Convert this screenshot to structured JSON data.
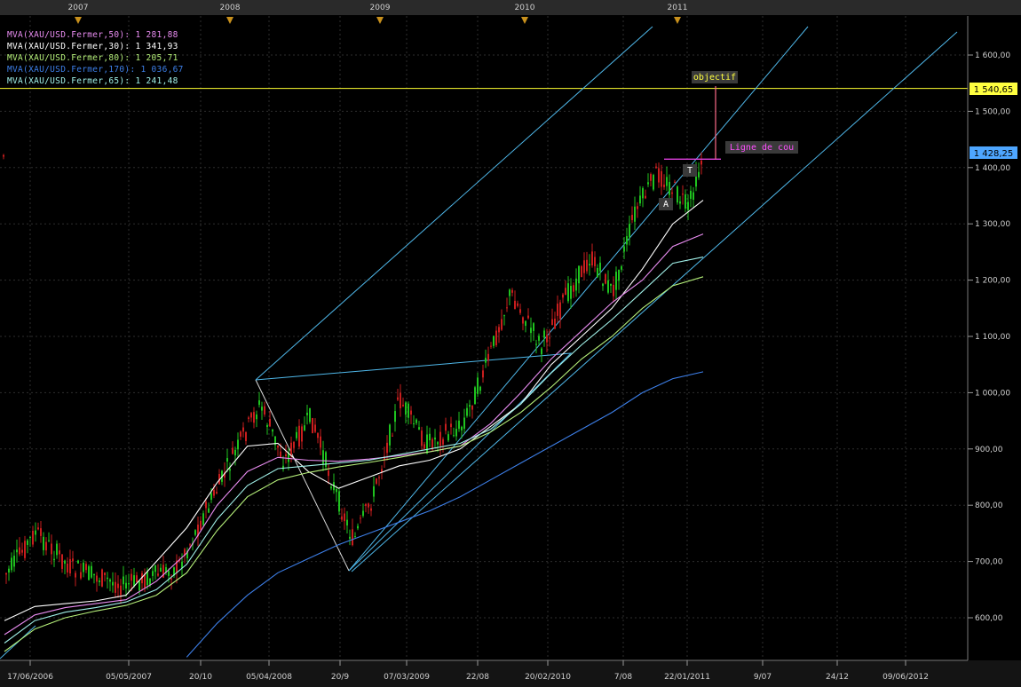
{
  "legend": [
    {
      "text": "MVA(XAU/USD.Fermer,50): 1 281,88",
      "color": "#e88cf0"
    },
    {
      "text": "MVA(XAU/USD.Fermer,30): 1 341,93",
      "color": "#ffffff"
    },
    {
      "text": "MVA(XAU/USD.Fermer,80): 1 205,71",
      "color": "#b6f07a"
    },
    {
      "text": "MVA(XAU/USD.Fermer,170): 1 036,67",
      "color": "#3d7fe8"
    },
    {
      "text": "MVA(XAU/USD.Fermer,65): 1 241,48",
      "color": "#a0f0e8"
    }
  ],
  "annotations": {
    "objectif": "objectif",
    "ligne_de_cou": "Ligne de cou",
    "label_a": "A",
    "label_t": "T"
  },
  "price_tags": {
    "target": "1 540,65",
    "current": "1 428,25"
  },
  "chart_data": {
    "type": "line",
    "instrument": "XAU/USD",
    "ylim": [
      530,
      1660
    ],
    "y_ticks": [
      "600,00",
      "700,00",
      "800,00",
      "900,00",
      "1 000,00",
      "1 100,00",
      "1 200,00",
      "1 300,00",
      "1 400,00",
      "1 500,00",
      "1 600,00"
    ],
    "y_tick_values": [
      600,
      700,
      800,
      900,
      1000,
      1100,
      1200,
      1300,
      1400,
      1500,
      1600
    ],
    "x_ticks_bottom": [
      "17/06/2006",
      "05/05/2007",
      "20/10",
      "05/04/2008",
      "20/9",
      "07/03/2009",
      "22/08",
      "20/02/2010",
      "7/08",
      "22/01/2011",
      "9/07",
      "24/12",
      "09/06/2012"
    ],
    "x_ticks_top": [
      "2007",
      "2008",
      "2009",
      "2010",
      "2011"
    ],
    "horizontal_line": 1540.65,
    "last_price": 1428.25,
    "neckline": 1415,
    "series": [
      {
        "name": "MVA(XAU/USD.Fermer,30)",
        "color": "#ffffff",
        "values": [
          595,
          620,
          625,
          630,
          640,
          700,
          760,
          840,
          905,
          910,
          860,
          830,
          850,
          870,
          880,
          900,
          940,
          980,
          1050,
          1100,
          1150,
          1220,
          1300,
          1342
        ]
      },
      {
        "name": "MVA(XAU/USD.Fermer,50)",
        "color": "#e88cf0",
        "values": [
          570,
          605,
          618,
          625,
          632,
          665,
          715,
          800,
          860,
          885,
          880,
          878,
          882,
          888,
          895,
          905,
          945,
          1000,
          1060,
          1110,
          1160,
          1200,
          1260,
          1282
        ]
      },
      {
        "name": "MVA(XAU/USD.Fermer,65)",
        "color": "#a0f0e8",
        "values": [
          555,
          595,
          610,
          618,
          628,
          650,
          695,
          775,
          835,
          865,
          870,
          875,
          880,
          890,
          900,
          910,
          935,
          980,
          1035,
          1085,
          1130,
          1180,
          1230,
          1241
        ]
      },
      {
        "name": "MVA(XAU/USD.Fermer,80)",
        "color": "#b6f07a",
        "values": [
          540,
          580,
          600,
          612,
          622,
          640,
          680,
          755,
          815,
          845,
          858,
          868,
          876,
          885,
          895,
          905,
          930,
          965,
          1010,
          1060,
          1100,
          1150,
          1190,
          1206
        ]
      },
      {
        "name": "MVA(XAU/USD.Fermer,170)",
        "color": "#3d7fe8",
        "values": [
          null,
          null,
          null,
          null,
          null,
          null,
          530,
          590,
          640,
          680,
          705,
          730,
          750,
          770,
          790,
          815,
          845,
          875,
          905,
          935,
          965,
          1000,
          1025,
          1037
        ]
      }
    ]
  }
}
